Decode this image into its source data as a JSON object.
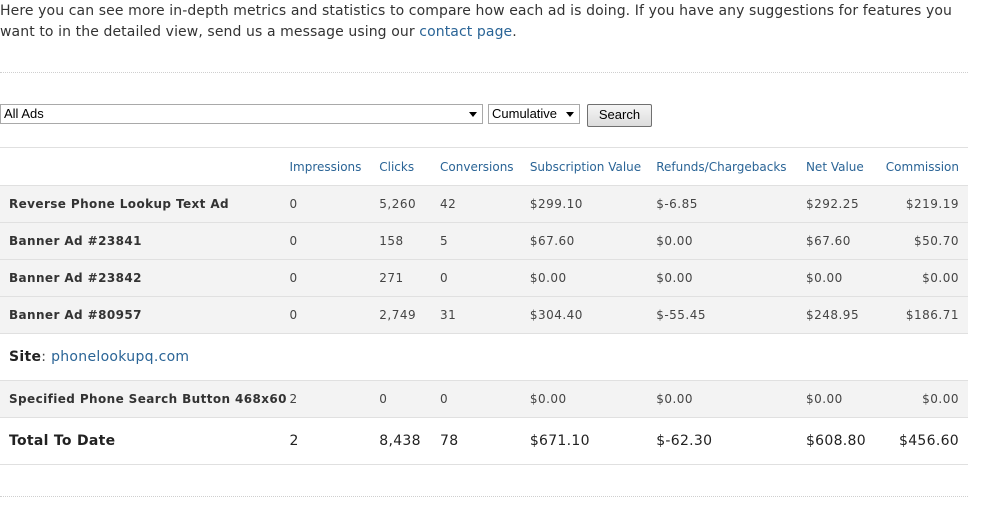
{
  "intro": {
    "text_before_link": "Here you can see more in-depth metrics and statistics to compare how each ad is doing. If you have any suggestions for features you want to in the detailed view, send us a message using our ",
    "link_text": "contact page",
    "text_after_link": "."
  },
  "filters": {
    "ad_select_value": "All Ads",
    "period_select_value": "Cumulative",
    "search_button_label": "Search"
  },
  "table": {
    "headers": {
      "name": "",
      "impressions": "Impressions",
      "clicks": "Clicks",
      "conversions": "Conversions",
      "subscription_value": "Subscription Value",
      "refunds": "Refunds/Chargebacks",
      "net_value": "Net Value",
      "commission": "Commission"
    },
    "rows": [
      {
        "name": "Reverse Phone Lookup Text Ad",
        "impressions": "0",
        "clicks": "5,260",
        "conversions": "42",
        "subscription_value": "$299.10",
        "refunds": "$-6.85",
        "net_value": "$292.25",
        "commission": "$219.19"
      },
      {
        "name": "Banner Ad #23841",
        "impressions": "0",
        "clicks": "158",
        "conversions": "5",
        "subscription_value": "$67.60",
        "refunds": "$0.00",
        "net_value": "$67.60",
        "commission": "$50.70"
      },
      {
        "name": "Banner Ad #23842",
        "impressions": "0",
        "clicks": "271",
        "conversions": "0",
        "subscription_value": "$0.00",
        "refunds": "$0.00",
        "net_value": "$0.00",
        "commission": "$0.00"
      },
      {
        "name": "Banner Ad #80957",
        "impressions": "0",
        "clicks": "2,749",
        "conversions": "31",
        "subscription_value": "$304.40",
        "refunds": "$-55.45",
        "net_value": "$248.95",
        "commission": "$186.71"
      }
    ],
    "site": {
      "label": "Site",
      "separator": ": ",
      "link": "phonelookupq.com"
    },
    "site_rows": [
      {
        "name": "Specified Phone Search Button 468x60",
        "impressions": "2",
        "clicks": "0",
        "conversions": "0",
        "subscription_value": "$0.00",
        "refunds": "$0.00",
        "net_value": "$0.00",
        "commission": "$0.00"
      }
    ],
    "total": {
      "name": "Total To Date",
      "impressions": "2",
      "clicks": "8,438",
      "conversions": "78",
      "subscription_value": "$671.10",
      "refunds": "$-62.30",
      "net_value": "$608.80",
      "commission": "$456.60"
    }
  }
}
